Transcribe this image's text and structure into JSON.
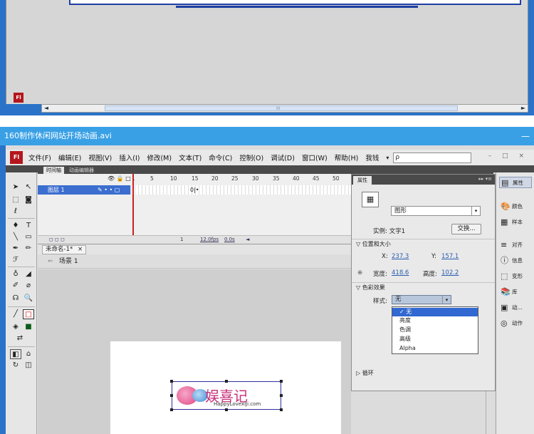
{
  "prev_window": {
    "scroll_left": "◄",
    "scroll_right": "►",
    "scroll_grip": "III",
    "logo": "Fl"
  },
  "window": {
    "title": "160制作休闲网站开场动画.avi",
    "title_dash": "—"
  },
  "menubar": {
    "logo": "Fl",
    "items": [
      "文件(F)",
      "编辑(E)",
      "视图(V)",
      "插入(I)",
      "修改(M)",
      "文本(T)",
      "命令(C)",
      "控制(O)",
      "调试(D)",
      "窗口(W)",
      "帮助(H)",
      "我钱"
    ],
    "dropdown": "▾",
    "search_placeholder": "",
    "search_icon": "ρ",
    "window_controls": "– □ ×"
  },
  "timeline": {
    "tabs": [
      "时间轴",
      "动画编辑器"
    ],
    "icons": "👁 🔒 □",
    "ruler": [
      "1",
      "5",
      "10",
      "15",
      "20",
      "25",
      "30",
      "35",
      "40",
      "45",
      "50"
    ],
    "layer_name": "图层 1",
    "layer_marks": "✎ • • ▢",
    "keyframe_mark": "0|•",
    "bottom_icons": "◻ ◻ ◻",
    "frame": "1",
    "fps": "12.0fps",
    "time": "0.0s",
    "nav_arrow": "◄"
  },
  "document": {
    "tab": "未命名-1*",
    "tab_close": "×",
    "back_arrow": "⇐",
    "scene": "场景 1",
    "logo_main": "娱喜记",
    "logo_sub": "HappyLovexiJi.com"
  },
  "properties": {
    "tab": "属性",
    "head_ctrl": "▸▸ ▾≡",
    "symbol_icon": "▦",
    "type": "图形",
    "instance_label": "实例: 文字1",
    "swap_button": "交换...",
    "section_position": "▽ 位置和大小",
    "x_label": "X:",
    "x_value": "237.3",
    "y_label": "Y:",
    "y_value": "157.1",
    "width_label": "宽度:",
    "width_value": "418.6",
    "height_label": "高度:",
    "height_value": "102.2",
    "lock_icon": "⊕",
    "section_color": "▽ 色彩效果",
    "style_label": "样式:",
    "style_selected": "无",
    "style_options": [
      "无",
      "亮度",
      "色调",
      "高级",
      "Alpha"
    ],
    "loop_label": "▷ 循环"
  },
  "dock": {
    "items": [
      {
        "icon": "▤",
        "label": "属性"
      },
      {
        "icon": "🎨",
        "label": "颜色"
      },
      {
        "icon": "▦",
        "label": "样本"
      },
      {
        "icon": "≡",
        "label": "对齐"
      },
      {
        "icon": "ⓘ",
        "label": "信息"
      },
      {
        "icon": "⬚",
        "label": "变形"
      },
      {
        "icon": "📚",
        "label": "库"
      },
      {
        "icon": "▣",
        "label": "动..."
      },
      {
        "icon": "◎",
        "label": "动作"
      }
    ]
  },
  "tools": {
    "items": [
      "➤",
      "↖",
      "⬚",
      "◙",
      "ℓ",
      "♦",
      "T",
      "╲",
      "▭",
      "✒",
      "✏",
      "ℱ",
      "♁",
      "◢",
      "✐",
      "⌀",
      "☊",
      "🔍",
      "╱",
      "□",
      "◈",
      "■",
      "⇄",
      "◧",
      "⌂",
      "↻",
      "◫"
    ]
  }
}
